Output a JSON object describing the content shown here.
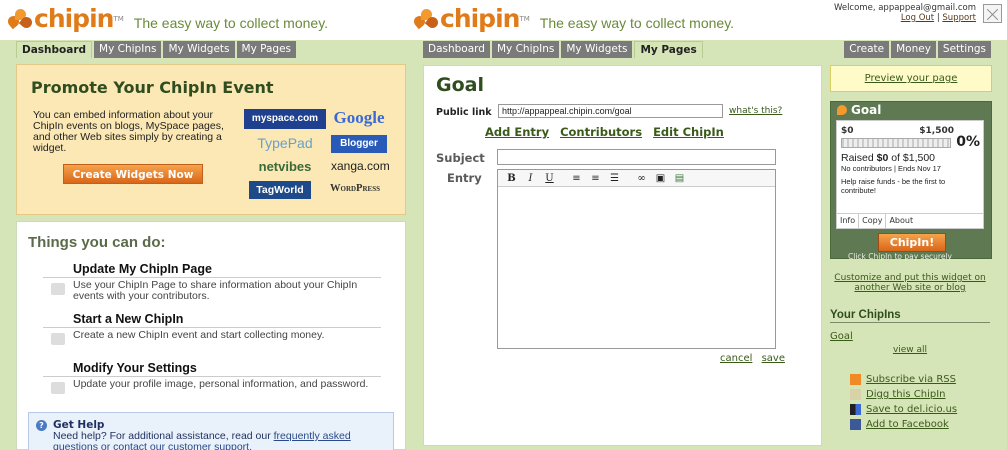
{
  "brand": {
    "name": "chipin",
    "tm": "TM",
    "tagline": "The easy way to collect money."
  },
  "left": {
    "tabs": [
      "Dashboard",
      "My ChipIns",
      "My Widgets",
      "My Pages"
    ],
    "promo": {
      "title": "Promote Your ChipIn Event",
      "body": "You can embed information about your ChipIn events on blogs, MySpace pages, and other Web sites simply by creating a widget.",
      "button": "Create Widgets Now",
      "partners": [
        "myspace.com",
        "Google",
        "TypePad",
        "Blogger",
        "netvibes",
        "xanga.com",
        "TagWorld",
        "WordPress"
      ]
    },
    "todo": {
      "title": "Things you can do:",
      "items": [
        {
          "title": "Update My ChipIn Page",
          "desc": "Use your ChipIn Page to share information about your ChipIn events with your contributors."
        },
        {
          "title": "Start a New ChipIn",
          "desc": "Create a new ChipIn event and start collecting money."
        },
        {
          "title": "Modify Your Settings",
          "desc": "Update your profile image, personal information, and password."
        }
      ],
      "help": {
        "title": "Get Help",
        "desc_pre": "Need help? For additional assistance, read our ",
        "desc_link": "frequently asked questions or contact our customer support."
      }
    }
  },
  "right": {
    "account": {
      "welcome": "Welcome, appappeal@gmail.com",
      "logout": "Log Out",
      "separator": "|",
      "support": "Support"
    },
    "tabs": [
      "Dashboard",
      "My ChipIns",
      "My Widgets",
      "My Pages"
    ],
    "right_tabs": [
      "Create",
      "Money",
      "Settings"
    ],
    "main": {
      "title": "Goal",
      "public_link_label": "Public link",
      "public_link_value": "http://appappeal.chipin.com/goal",
      "whats_this": "what's this?",
      "actions": [
        "Add Entry",
        "Contributors",
        "Edit ChipIn"
      ],
      "subject_label": "Subject",
      "entry_label": "Entry",
      "toolbar": [
        "B",
        "I",
        "U"
      ],
      "cancel": "cancel",
      "save": "save"
    },
    "sidebar": {
      "preview": "Preview your page",
      "widget": {
        "title": "Goal",
        "min": "$0",
        "max": "$1,500",
        "percent_label": "0%",
        "progress": 0,
        "raised_pre": "Raised ",
        "raised_amount": "$0",
        "raised_post": " of $1,500",
        "meta": "No contributors | Ends Nov 17",
        "cta": "Help raise funds - be the first to contribute!",
        "tabs": [
          "Info",
          "Copy",
          "About"
        ],
        "button": "ChipIn!",
        "secure": "Click ChipIn to pay securely"
      },
      "customize": "Customize and put this widget on another Web site or blog",
      "your_chipins": "Your ChipIns",
      "chipin_item": "Goal",
      "view_all": "view all",
      "social": [
        "Subscribe via RSS",
        "Digg this ChipIn",
        "Save to del.icio.us",
        "Add to Facebook"
      ]
    }
  }
}
